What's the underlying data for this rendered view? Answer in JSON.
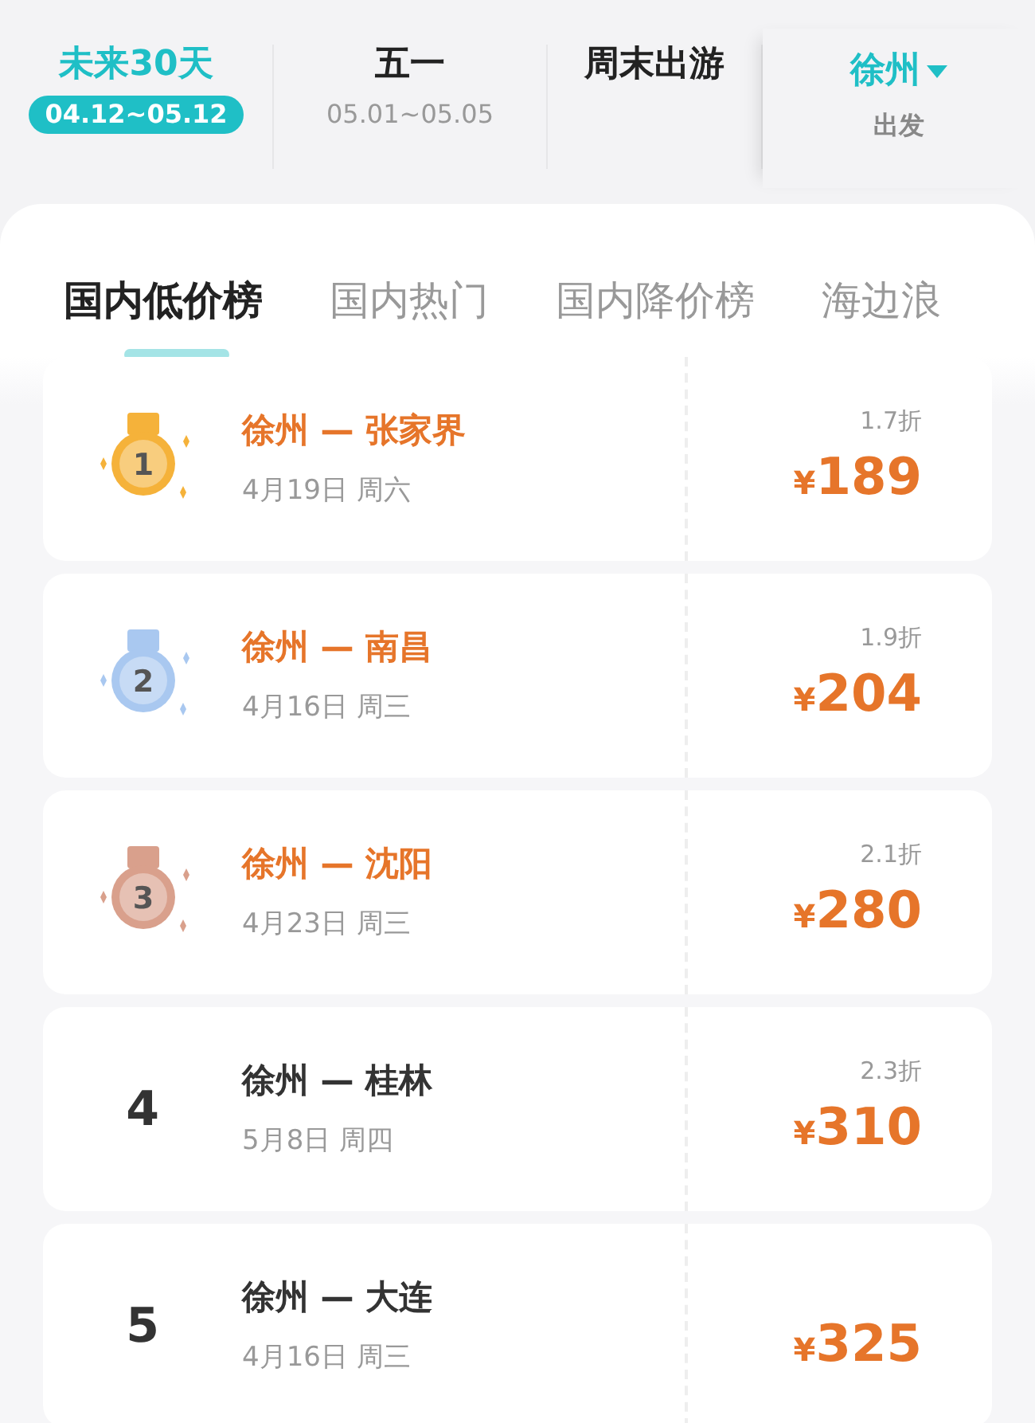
{
  "date_filters": [
    {
      "title": "未来30天",
      "range": "04.12~05.12",
      "selected": true
    },
    {
      "title": "五一",
      "range": "05.01~05.05",
      "selected": false
    },
    {
      "title": "周末出游",
      "selected": false
    }
  ],
  "departure": {
    "city": "徐州",
    "label": "出发"
  },
  "tabs": [
    {
      "label": "国内低价榜",
      "selected": true
    },
    {
      "label": "国内热门",
      "selected": false
    },
    {
      "label": "国内降价榜",
      "selected": false
    },
    {
      "label": "海边浪",
      "selected": false
    }
  ],
  "routes": [
    {
      "kind": "medal",
      "rank": "1",
      "color": "#f5b23a",
      "route": "徐州 — 张家界",
      "date": "4月19日 周六",
      "discount": "1.7折",
      "currency": "¥",
      "price": "189"
    },
    {
      "kind": "medal",
      "rank": "2",
      "color": "#a9c8f0",
      "route": "徐州 — 南昌",
      "date": "4月16日 周三",
      "discount": "1.9折",
      "currency": "¥",
      "price": "204"
    },
    {
      "kind": "medal",
      "rank": "3",
      "color": "#d9a08c",
      "route": "徐州 — 沈阳",
      "date": "4月23日 周三",
      "discount": "2.1折",
      "currency": "¥",
      "price": "280"
    },
    {
      "kind": "number",
      "rank": "4",
      "route": "徐州 — 桂林",
      "date": "5月8日 周四",
      "discount": "2.3折",
      "currency": "¥",
      "price": "310"
    },
    {
      "kind": "number",
      "rank": "5",
      "route": "徐州 — 大连",
      "date": "4月16日 周三",
      "currency": "¥",
      "price": "325"
    }
  ]
}
